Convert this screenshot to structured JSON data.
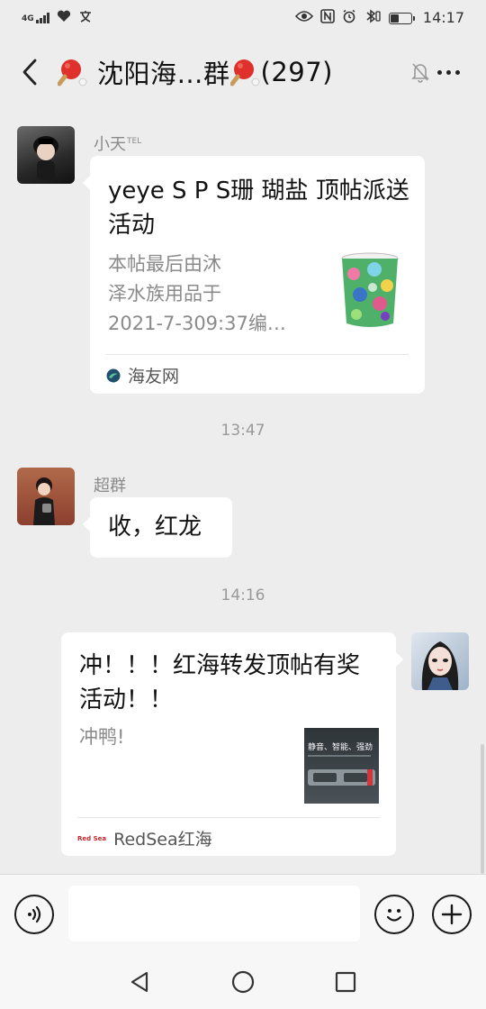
{
  "status_bar": {
    "network": "4G",
    "time": "14:17"
  },
  "header": {
    "title": "沈阳海…群",
    "member_count": "(297)"
  },
  "messages": [
    {
      "type": "link-card",
      "sender": "小天",
      "sender_badge": "TEL",
      "card_title": "yeye S P S珊 瑚盐 顶帖派送活动",
      "card_desc_lines": [
        "本帖最后由沐",
        "泽水族用品于",
        "2021-7-309:37编…"
      ],
      "source": "海友网"
    },
    {
      "type": "timestamp",
      "text": "13:47"
    },
    {
      "type": "text",
      "sender": "超群",
      "text": "收，红龙"
    },
    {
      "type": "timestamp",
      "text": "14:16"
    },
    {
      "type": "link-card",
      "sender": "me",
      "card_title": "冲！！！红海转发顶帖有奖活动！！",
      "card_desc": "冲鸭!",
      "thumb_text": "静音、智能、强劲",
      "source": "RedSea红海",
      "source_logo_text": "Red Sea"
    }
  ],
  "colors": {
    "background": "#ededed",
    "bubble": "#ffffff",
    "secondary_text": "#8a8a8a"
  }
}
